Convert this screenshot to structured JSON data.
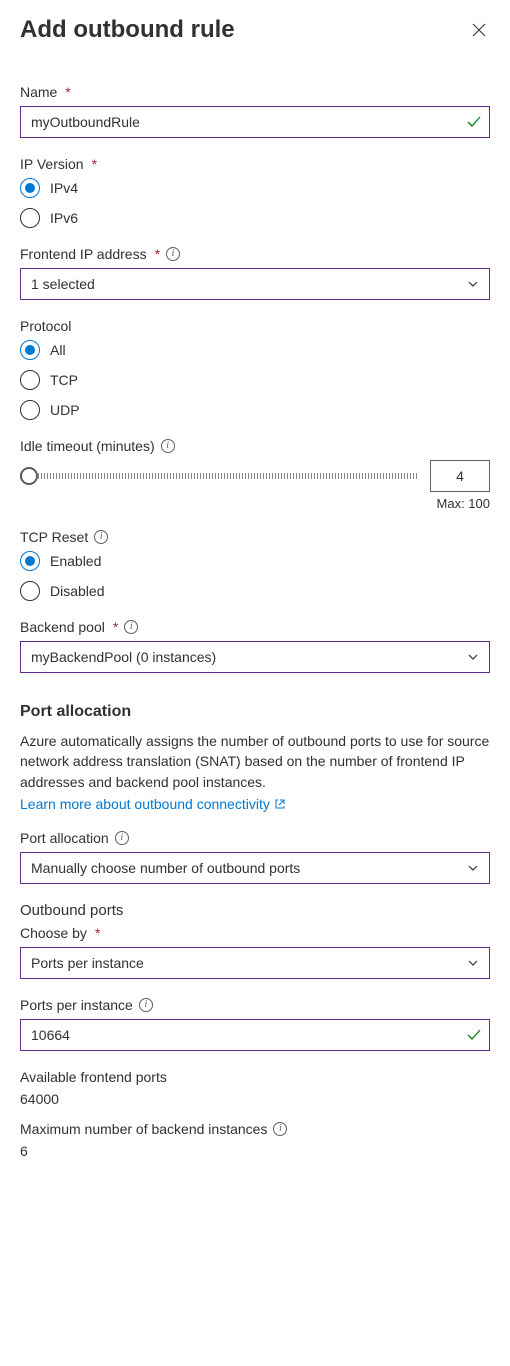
{
  "header": {
    "title": "Add outbound rule"
  },
  "name": {
    "label": "Name",
    "value": "myOutboundRule"
  },
  "ipVersion": {
    "label": "IP Version",
    "options": [
      "IPv4",
      "IPv6"
    ],
    "selected": "IPv4"
  },
  "frontendIp": {
    "label": "Frontend IP address",
    "value": "1 selected"
  },
  "protocol": {
    "label": "Protocol",
    "options": [
      "All",
      "TCP",
      "UDP"
    ],
    "selected": "All"
  },
  "idleTimeout": {
    "label": "Idle timeout (minutes)",
    "value": "4",
    "maxLabel": "Max: 100"
  },
  "tcpReset": {
    "label": "TCP Reset",
    "options": [
      "Enabled",
      "Disabled"
    ],
    "selected": "Enabled"
  },
  "backendPool": {
    "label": "Backend pool",
    "value": "myBackendPool (0 instances)"
  },
  "portAllocation": {
    "sectionTitle": "Port allocation",
    "desc": "Azure automatically assigns the number of outbound ports to use for source network address translation (SNAT) based on the number of frontend IP addresses and backend pool instances.",
    "learnMore": "Learn more about outbound connectivity",
    "fieldLabel": "Port allocation",
    "value": "Manually choose number of outbound ports"
  },
  "outboundPorts": {
    "sectionTitle": "Outbound ports",
    "chooseByLabel": "Choose by",
    "chooseByValue": "Ports per instance",
    "portsPerInstanceLabel": "Ports per instance",
    "portsPerInstanceValue": "10664",
    "availableLabel": "Available frontend ports",
    "availableValue": "64000",
    "maxBackendLabel": "Maximum number of backend instances",
    "maxBackendValue": "6"
  }
}
